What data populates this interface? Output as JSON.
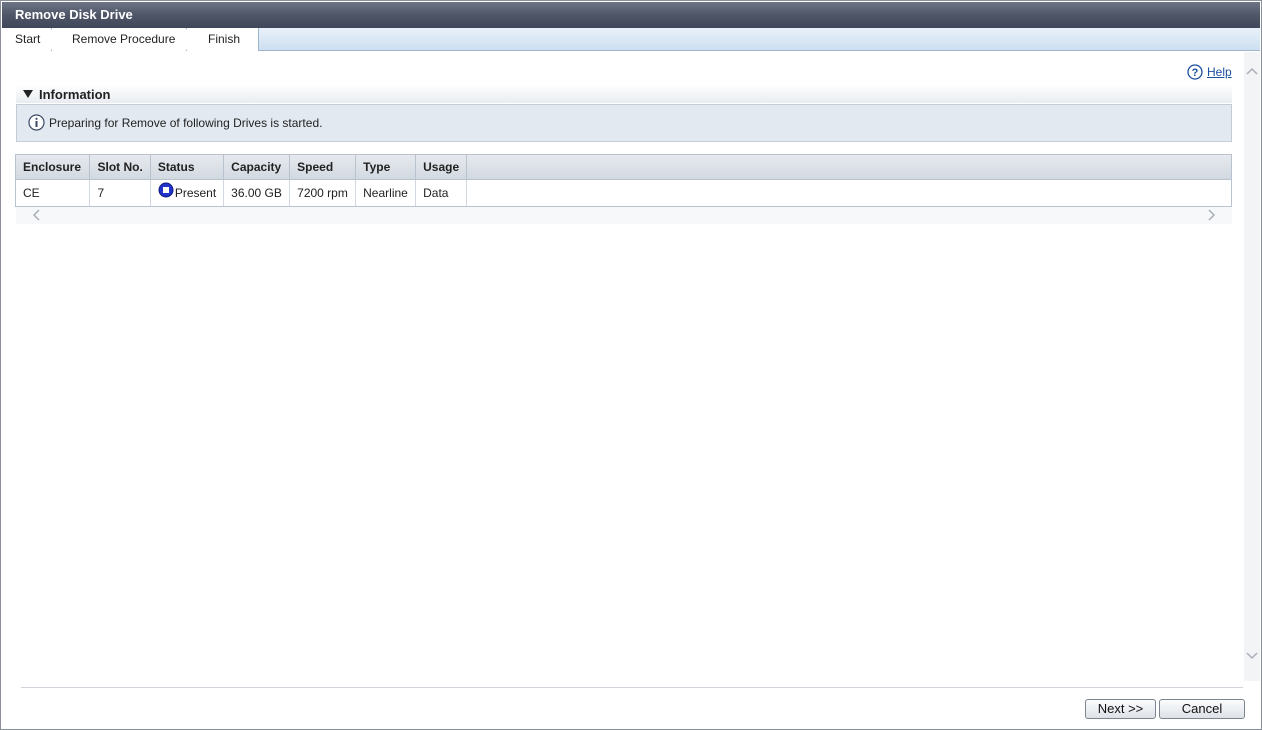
{
  "window": {
    "title": "Remove Disk Drive"
  },
  "steps": [
    {
      "label": "Start"
    },
    {
      "label": "Remove Procedure"
    },
    {
      "label": "Finish"
    }
  ],
  "help": {
    "label": "Help"
  },
  "section": {
    "title": "Information"
  },
  "info": {
    "message": "Preparing for Remove of following Drives is started."
  },
  "table": {
    "headers": [
      "Enclosure",
      "Slot No.",
      "Status",
      "Capacity",
      "Speed",
      "Type",
      "Usage"
    ],
    "rows": [
      {
        "enclosure": "CE",
        "slot": "7",
        "status": "Present",
        "capacity": "36.00 GB",
        "speed": "7200 rpm",
        "type": "Nearline",
        "usage": "Data"
      }
    ]
  },
  "buttons": {
    "next": "Next >>",
    "cancel": "Cancel"
  },
  "colors": {
    "title_bar": "#4f5668",
    "step_bar": "#cddff1",
    "info_bg": "#e3e9f1",
    "link": "#1a4fa0",
    "status_icon": "#2233cc"
  },
  "icons": {
    "help": "question-circle-icon",
    "info": "info-circle-icon",
    "status": "present-status-icon",
    "collapse": "triangle-down-icon"
  }
}
